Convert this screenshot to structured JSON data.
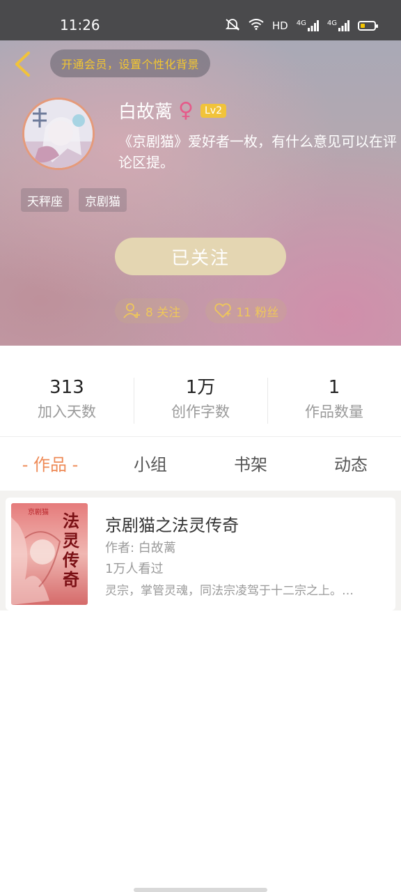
{
  "status_bar": {
    "time": "11:26",
    "network_label": "HD",
    "signal_label_1": "4G",
    "signal_label_2": "4G"
  },
  "header": {
    "vip_banner": "开通会员，设置个性化背景",
    "username": "白故蓠",
    "gender_symbol": "♀",
    "level": "Lv2",
    "bio": "《京剧猫》爱好者一枚，有什么意见可以在评论区提。",
    "tags": [
      "天秤座",
      "京剧猫"
    ],
    "follow_button": "已关注",
    "following": "8 关注",
    "fans": "11 粉丝"
  },
  "stats": [
    {
      "value": "313",
      "label": "加入天数"
    },
    {
      "value": "1万",
      "label": "创作字数"
    },
    {
      "value": "1",
      "label": "作品数量"
    }
  ],
  "tabs": [
    "- 作品 -",
    "小组",
    "书架",
    "动态"
  ],
  "works": [
    {
      "cover_title": "法灵传奇",
      "cover_brand": "京剧猫",
      "title": "京剧猫之法灵传奇",
      "author": "作者: 白故蓠",
      "views": "1万人看过",
      "description": "灵宗，掌管灵魂，同法宗凌驾于十二宗之上。…"
    }
  ],
  "colors": {
    "accent": "#ee8a56",
    "gold": "#f1c33a",
    "follow_button_bg": "#e4d6b2",
    "gender": "#e55b8a"
  }
}
